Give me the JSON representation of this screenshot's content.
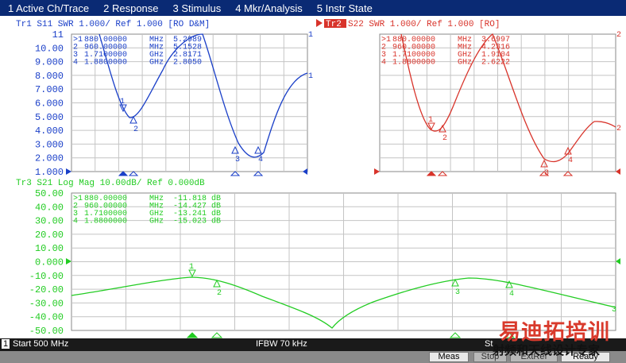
{
  "menu": {
    "items": [
      "1 Active Ch/Trace",
      "2 Response",
      "3 Stimulus",
      "4 Mkr/Analysis",
      "5 Instr State"
    ]
  },
  "colors": {
    "tr1": "#1a3fc8",
    "tr2": "#d8332a",
    "tr3": "#22cc22",
    "menubar": "#0a2a74",
    "grid": "#c4c4c4"
  },
  "charts": {
    "tr1": {
      "title": "Tr1  S11  SWR 1.000/ Ref 1.000  [RO D&M]",
      "yticks": [
        "11",
        "10.00",
        "9.000",
        "8.000",
        "7.000",
        "6.000",
        "5.000",
        "4.000",
        "3.000",
        "2.000",
        "1.000"
      ],
      "markers": [
        {
          "label": ">1",
          "freq": "880.00000",
          "unit": "MHz",
          "value": "5.2989"
        },
        {
          "label": "2",
          "freq": "960.00000",
          "unit": "MHz",
          "value": "5.1528"
        },
        {
          "label": "3",
          "freq": "1.7100000",
          "unit": "GHz",
          "value": "2.8171"
        },
        {
          "label": "4",
          "freq": "1.8800000",
          "unit": "GHz",
          "value": "2.8050"
        }
      ],
      "trace_label": "1"
    },
    "tr2": {
      "badge": "Tr2",
      "title": " S22  SWR 1.000/ Ref 1.000  [RO]",
      "markers": [
        {
          "label": ">1",
          "freq": "880.00000",
          "unit": "MHz",
          "value": "3.6997"
        },
        {
          "label": "2",
          "freq": "960.00000",
          "unit": "MHz",
          "value": "4.2316"
        },
        {
          "label": "3",
          "freq": "1.7100000",
          "unit": "GHz",
          "value": "1.9104"
        },
        {
          "label": "4",
          "freq": "1.8800000",
          "unit": "GHz",
          "value": "2.6222"
        }
      ],
      "trace_label": "2"
    },
    "tr3": {
      "title": "Tr3  S21  Log Mag 10.00dB/ Ref 0.000dB",
      "yticks": [
        "50.00",
        "40.00",
        "30.00",
        "20.00",
        "10.00",
        "0.000",
        "-10.00",
        "-20.00",
        "-30.00",
        "-40.00",
        "-50.00"
      ],
      "markers": [
        {
          "label": ">1",
          "freq": "880.00000",
          "unit": "MHz",
          "value": "-11.818 dB"
        },
        {
          "label": "2",
          "freq": "960.00000",
          "unit": "MHz",
          "value": "-14.427 dB"
        },
        {
          "label": "3",
          "freq": "1.7100000",
          "unit": "GHz",
          "value": "-13.241 dB"
        },
        {
          "label": "4",
          "freq": "1.8800000",
          "unit": "GHz",
          "value": "-15.023 dB"
        }
      ],
      "trace_label": "3"
    }
  },
  "status": {
    "channel": "1",
    "start": "Start 500 MHz",
    "ifbw": "IFBW 70 kHz",
    "stop": "St"
  },
  "softkeys": [
    "Meas",
    "Stop",
    "ExtRef",
    "Ready"
  ],
  "watermark": {
    "title": "易迪拓培训",
    "subtitle": "射频和天线设计专家"
  }
}
